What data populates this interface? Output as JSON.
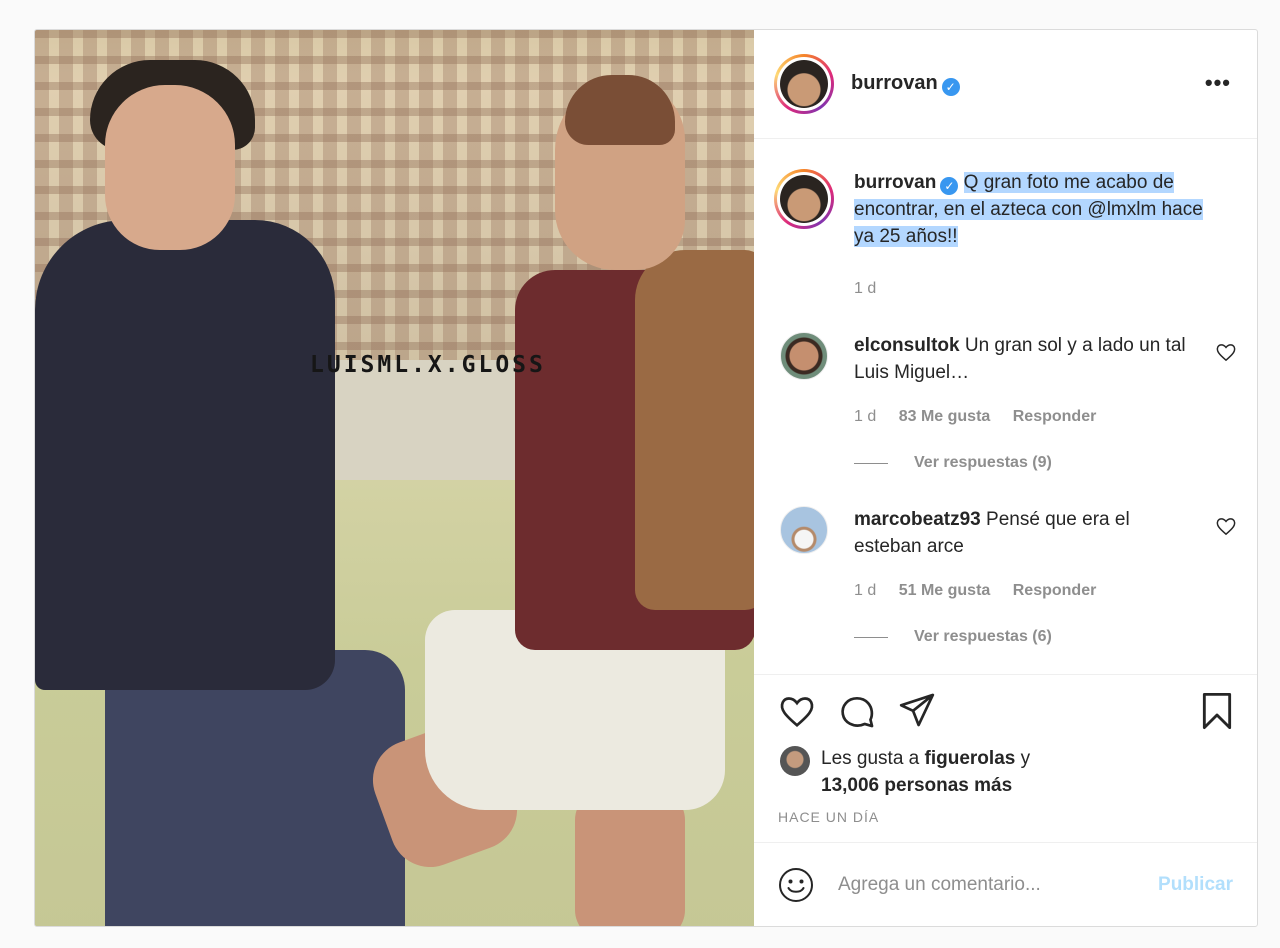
{
  "photo": {
    "watermark": "LUISML.X.GLOSS"
  },
  "header": {
    "username": "burrovan",
    "verified_glyph": "✓",
    "more_label": "•••"
  },
  "caption": {
    "username": "burrovan",
    "verified_glyph": "✓",
    "text": "Q gran foto me acabo de encontrar, en el azteca con @lmxlm hace ya 25 años!!",
    "age": "1 d"
  },
  "comments": [
    {
      "username": "elconsultok",
      "text": "Un gran sol y a lado un tal Luis Miguel…",
      "age": "1 d",
      "likes": "83 Me gusta",
      "reply_label": "Responder",
      "view_replies": "Ver respuestas (9)"
    },
    {
      "username": "marcobeatz93",
      "text": "Pensé que era el esteban arce",
      "age": "1 d",
      "likes": "51 Me gusta",
      "reply_label": "Responder",
      "view_replies": "Ver respuestas (6)"
    }
  ],
  "actions": {
    "icons": [
      "heart-icon",
      "comment-icon",
      "share-icon",
      "bookmark-icon"
    ],
    "likes_prefix": "Les gusta a ",
    "likes_user": "figuerolas",
    "likes_join": " y",
    "likes_count": "13,006 personas más",
    "timestamp": "HACE UN DÍA"
  },
  "add_comment": {
    "placeholder": "Agrega un comentario...",
    "publish_label": "Publicar"
  },
  "colors": {
    "accent": "#3897f0",
    "highlight": "#b3d7ff",
    "muted_text": "#8e8e8e",
    "publish_disabled": "#b2dffc"
  }
}
